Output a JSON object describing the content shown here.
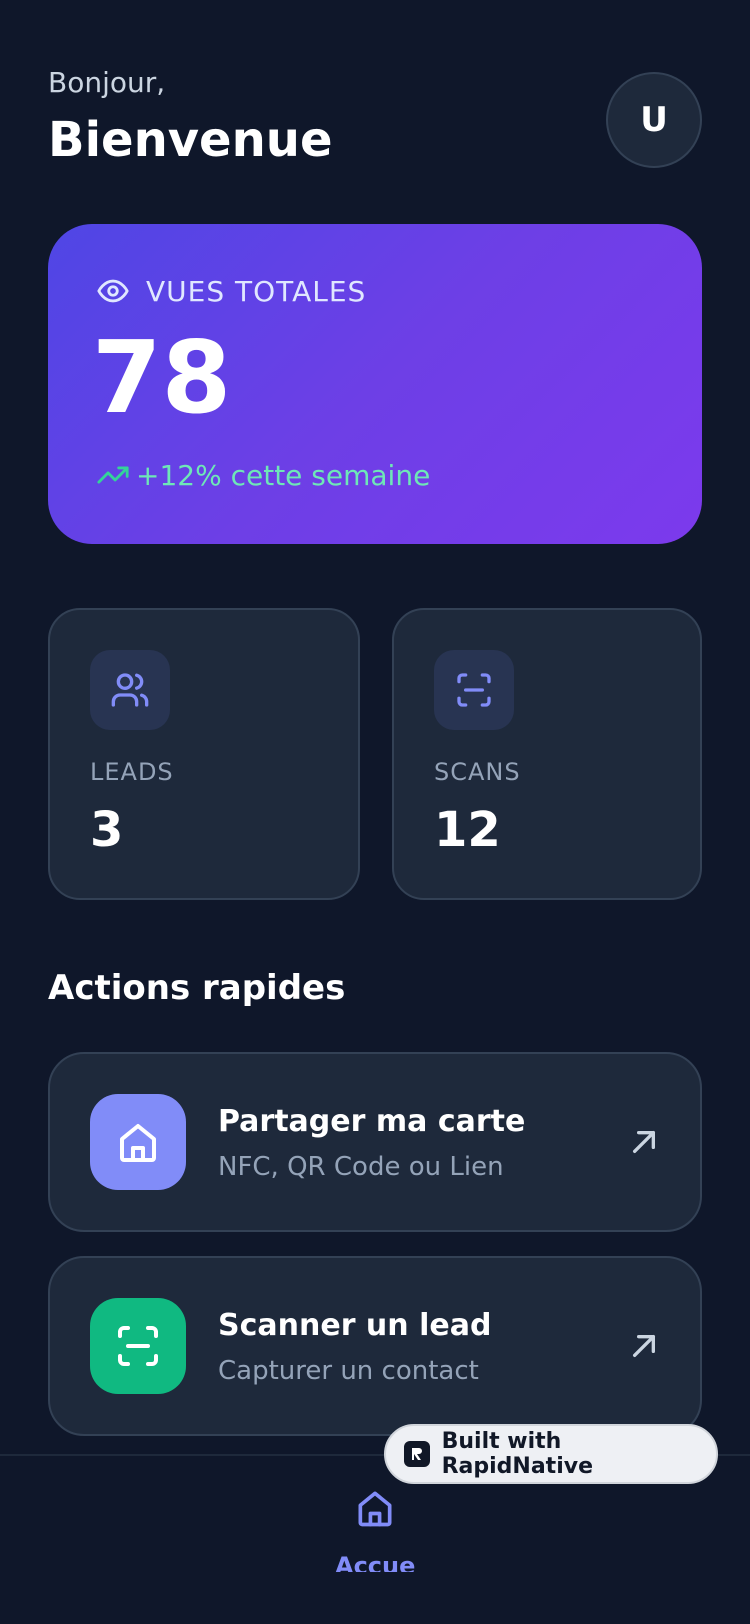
{
  "header": {
    "greeting": "Bonjour,",
    "title": "Bienvenue",
    "avatar_initial": "U"
  },
  "hero": {
    "label": "VUES TOTALES",
    "value": "78",
    "trend": "+12% cette semaine",
    "icon": "eye-icon",
    "trend_icon": "trending-up-icon"
  },
  "stats": [
    {
      "label": "LEADS",
      "value": "3",
      "icon": "users-icon"
    },
    {
      "label": "SCANS",
      "value": "12",
      "icon": "scan-icon"
    }
  ],
  "quick_actions": {
    "title": "Actions rapides",
    "items": [
      {
        "title": "Partager ma carte",
        "subtitle": "NFC, QR Code ou Lien",
        "icon": "home-icon",
        "color": "#818cf8"
      },
      {
        "title": "Scanner un lead",
        "subtitle": "Capturer un contact",
        "icon": "scan-icon",
        "color": "#10b981"
      }
    ]
  },
  "bottom_nav": {
    "items": [
      {
        "label": "Accueil",
        "icon": "home-icon",
        "active": true
      }
    ]
  },
  "badge": {
    "text": "Built with RapidNative"
  },
  "colors": {
    "background": "#0f172a",
    "card": "#1e293b",
    "accent": "#818cf8",
    "success": "#10b981",
    "hero_gradient_start": "#4f46e5",
    "hero_gradient_end": "#7c3aed"
  }
}
